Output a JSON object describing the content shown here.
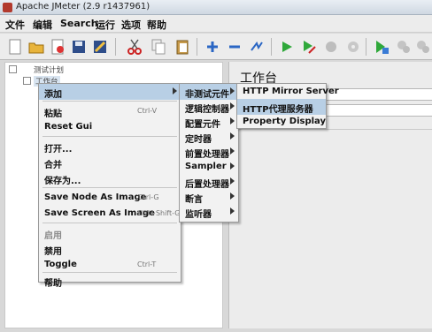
{
  "window": {
    "title": "Apache JMeter (2.9 r1437961)"
  },
  "menubar": {
    "items": [
      "文件",
      "编辑",
      "Search",
      "运行",
      "选项",
      "帮助"
    ]
  },
  "toolbar": {
    "buttons": [
      "new-icon",
      "open-icon",
      "close-icon",
      "save-icon",
      "save-as-icon",
      "cut-icon",
      "copy-icon",
      "paste-icon",
      "expand-icon",
      "collapse-icon",
      "toggle-icon",
      "start-icon",
      "start-no-pause-icon",
      "stop-icon",
      "shutdown-icon",
      "remote-start-icon",
      "remote-stop-icon",
      "remote-exit-icon"
    ]
  },
  "tree": {
    "root_label": "测试计划",
    "child_label": "工作台"
  },
  "right_panel": {
    "heading": "工作台"
  },
  "context_menu": {
    "items": [
      {
        "label": "添加",
        "shortcut": "",
        "submenu": true
      },
      {
        "label": "粘贴",
        "shortcut": "Ctrl-V"
      },
      {
        "label": "Reset Gui",
        "shortcut": ""
      },
      {
        "label": "打开...",
        "shortcut": ""
      },
      {
        "label": "合并",
        "shortcut": ""
      },
      {
        "label": "保存为...",
        "shortcut": ""
      },
      {
        "label": "Save Node As Image",
        "shortcut": "Ctrl-G"
      },
      {
        "label": "Save Screen As Image",
        "shortcut": "Ctrl+Shift-G"
      },
      {
        "label": "启用",
        "shortcut": "",
        "disabled": true
      },
      {
        "label": "禁用",
        "shortcut": ""
      },
      {
        "label": "Toggle",
        "shortcut": "Ctrl-T"
      },
      {
        "label": "帮助",
        "shortcut": ""
      }
    ]
  },
  "add_submenu": {
    "items": [
      "非测试元件",
      "逻辑控制器",
      "配置元件",
      "定时器",
      "前置处理器",
      "Sampler",
      "后置处理器",
      "断言",
      "监听器"
    ]
  },
  "non_test_submenu": {
    "items": [
      "HTTP Mirror Server",
      "HTTP代理服务器",
      "Property Display"
    ]
  }
}
